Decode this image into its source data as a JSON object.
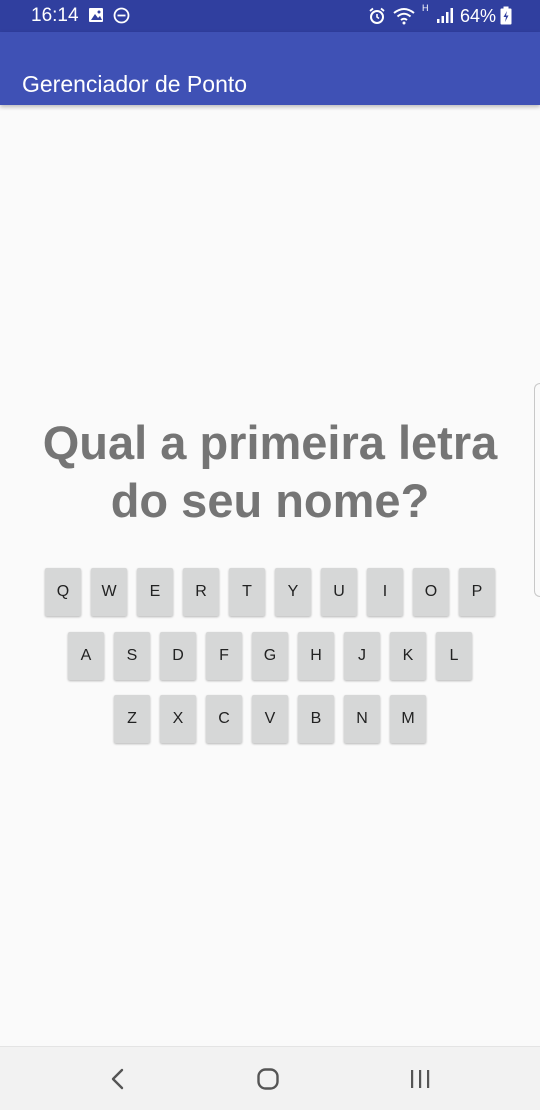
{
  "status_bar": {
    "time": "16:14",
    "battery": "64%",
    "network_label": "H",
    "icons": [
      "gallery-icon",
      "do-not-disturb-icon",
      "alarm-icon",
      "wifi-icon",
      "signal-icon",
      "battery-icon"
    ]
  },
  "app_bar": {
    "title": "Gerenciador de Ponto",
    "color": "#3f51b5",
    "status_color": "#303f9f"
  },
  "question": {
    "line1": "Qual a primeira letra",
    "line2": "do seu nome?"
  },
  "keyboard": {
    "row1": [
      "Q",
      "W",
      "E",
      "R",
      "T",
      "Y",
      "U",
      "I",
      "O",
      "P"
    ],
    "row2": [
      "A",
      "S",
      "D",
      "F",
      "G",
      "H",
      "J",
      "K",
      "L"
    ],
    "row3": [
      "Z",
      "X",
      "C",
      "V",
      "B",
      "N",
      "M"
    ]
  },
  "nav_bar": {
    "buttons": [
      "back-icon",
      "home-icon",
      "recents-icon"
    ]
  }
}
